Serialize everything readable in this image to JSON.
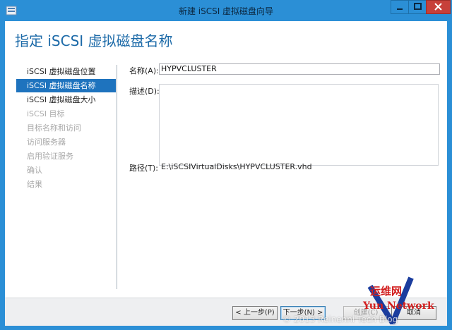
{
  "window": {
    "title": "新建 iSCSI 虚拟磁盘向导"
  },
  "page": {
    "heading": "指定 iSCSI 虚拟磁盘名称"
  },
  "steps": [
    {
      "label": "iSCSI 虚拟磁盘位置",
      "state": "normal"
    },
    {
      "label": "iSCSI 虚拟磁盘名称",
      "state": "active"
    },
    {
      "label": "iSCSI 虚拟磁盘大小",
      "state": "normal"
    },
    {
      "label": "iSCSI 目标",
      "state": "disabled"
    },
    {
      "label": "目标名称和访问",
      "state": "disabled"
    },
    {
      "label": "访问服务器",
      "state": "disabled"
    },
    {
      "label": "启用验证服务",
      "state": "disabled"
    },
    {
      "label": "确认",
      "state": "disabled"
    },
    {
      "label": "结果",
      "state": "disabled"
    }
  ],
  "form": {
    "name_label": "名称(A):",
    "name_value": "HYPVCLUSTER",
    "description_label": "描述(D):",
    "description_value": "",
    "path_label": "路径(T):",
    "path_value": "E:\\iSCSIVirtualDisks\\HYPVCLUSTER.vhd"
  },
  "buttons": {
    "previous": "< 上一步(P)",
    "next": "下一步(N) >",
    "create": "创建(C)",
    "cancel": "取消"
  },
  "watermark": {
    "copyright": "© 2013 Reinenni Tech Blog",
    "logo_cn": "运维网",
    "logo_en": "Yun Network"
  },
  "colors": {
    "titlebar": "#2b8fd6",
    "heading": "#1c6aa8",
    "active_step": "#1e73be",
    "close_button": "#c7403a"
  }
}
